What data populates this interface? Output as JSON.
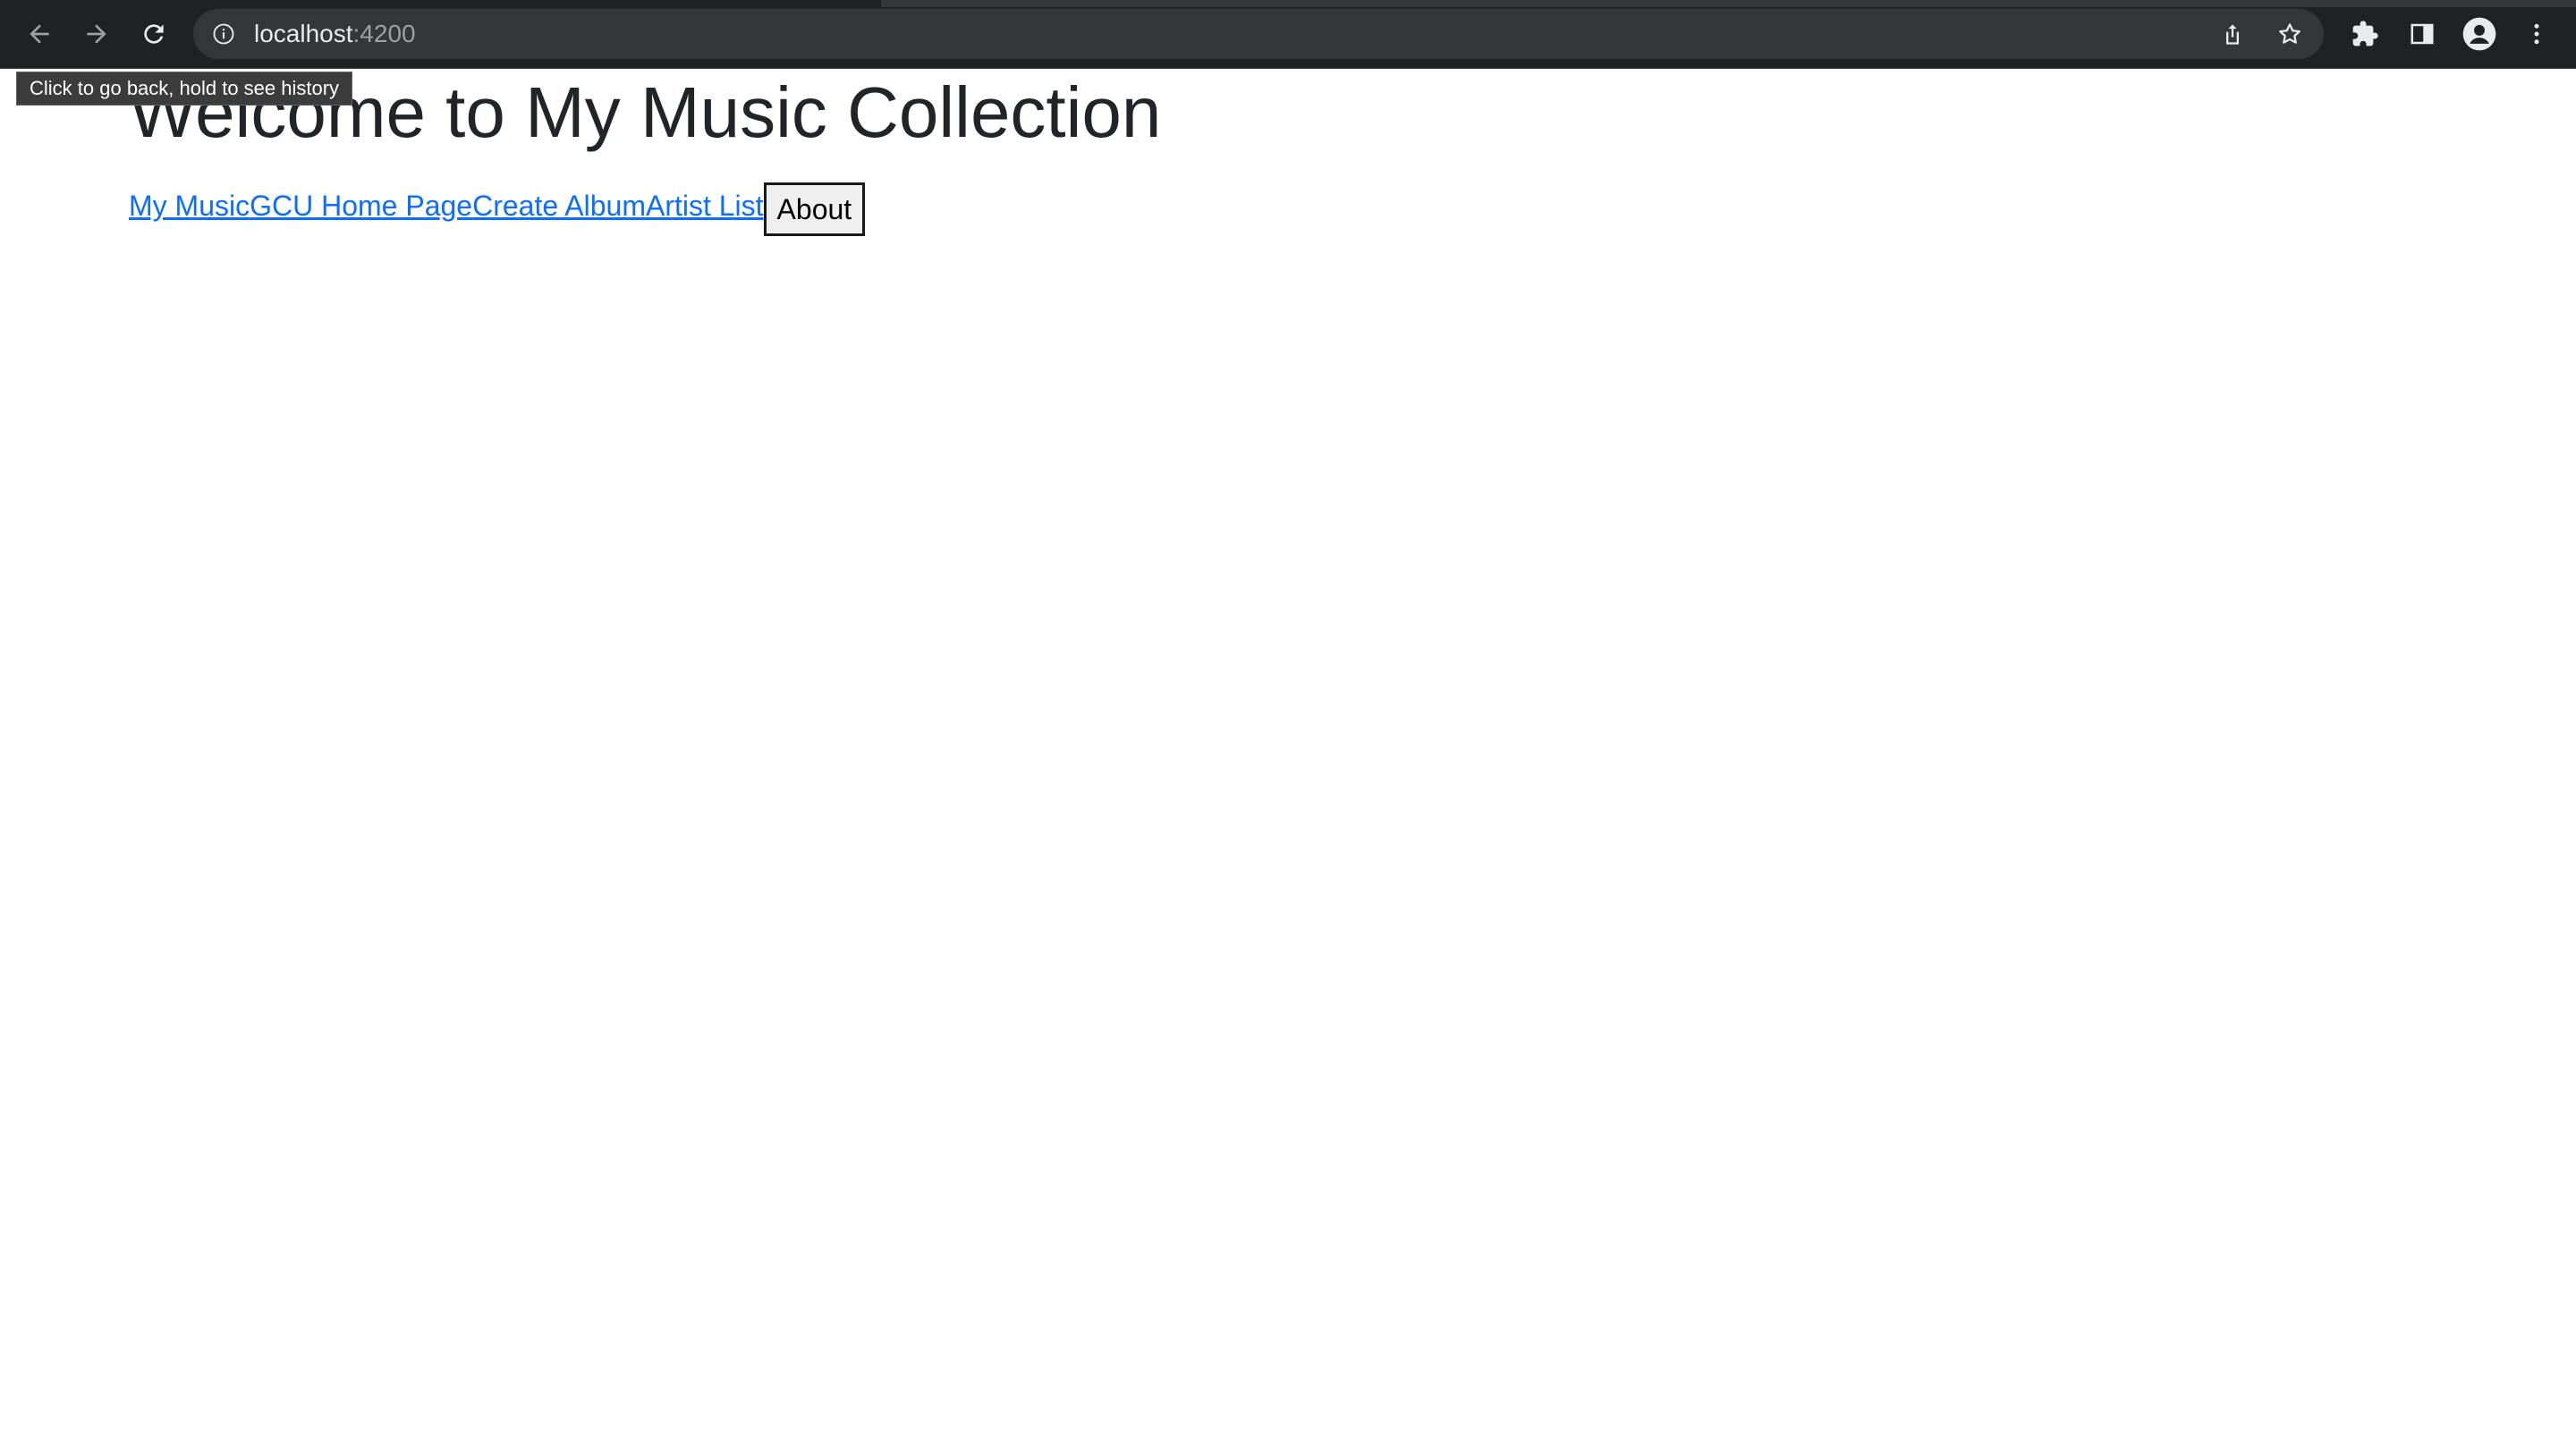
{
  "browser": {
    "url_host": "localhost",
    "url_port": ":4200",
    "back_tooltip": "Click to go back, hold to see history",
    "icons": {
      "back": "arrow-left-icon",
      "forward": "arrow-right-icon",
      "reload": "reload-icon",
      "site_info": "info-icon",
      "share": "share-icon",
      "bookmark": "star-icon",
      "extensions": "puzzle-icon",
      "side_panel": "side-panel-icon",
      "profile": "profile-icon",
      "menu": "kebab-menu-icon"
    },
    "colors": {
      "toolbar": "#202124",
      "omnibox": "#35363a",
      "icon": "#e8eaed",
      "icon_disabled": "#9aa0a6"
    }
  },
  "page": {
    "title": "Welcome to My Music Collection",
    "nav": {
      "links": [
        "My Music",
        "GCU Home Page",
        "Create Album",
        "Artist List"
      ],
      "about_button": "About"
    },
    "colors": {
      "link": "#0d6efd",
      "title": "#212529",
      "background": "#ffffff"
    }
  }
}
